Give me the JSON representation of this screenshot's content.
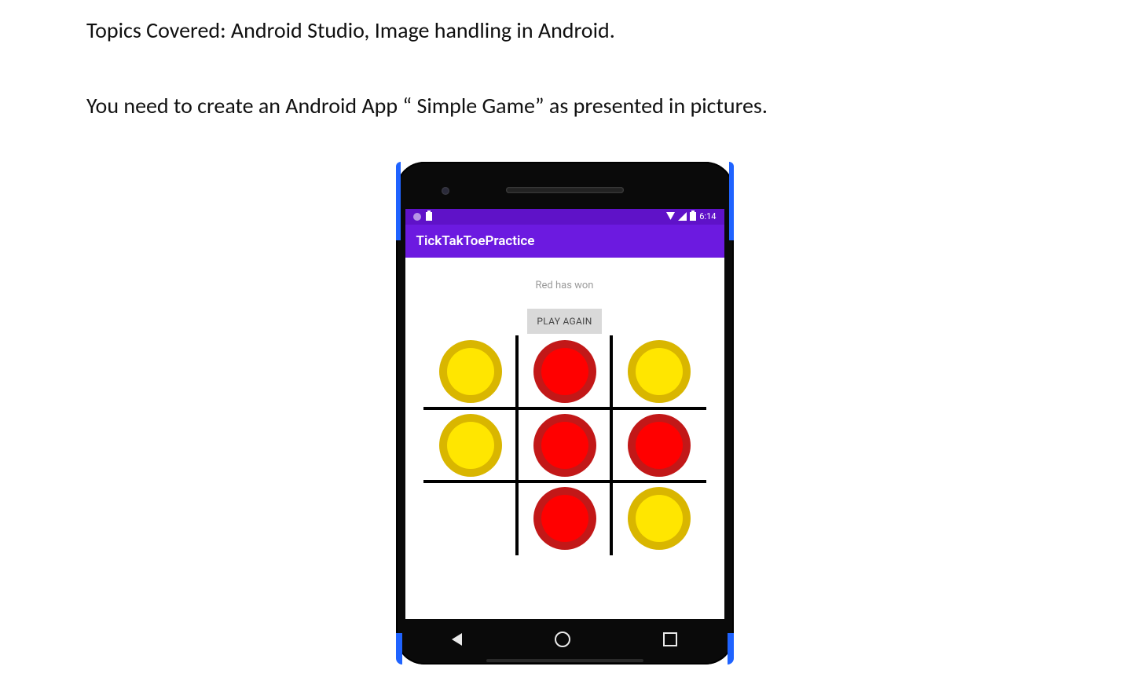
{
  "document": {
    "topic_line": "Topics Covered: Android Studio, Image handling in Android.",
    "assignment_line": "You need to create an Android App “ Simple Game” as presented in pictures."
  },
  "phone": {
    "status": {
      "time": "6:14"
    },
    "app_title": "TickTakToePractice",
    "result_text": "Red has won",
    "play_again_label": "PLAY AGAIN",
    "board": {
      "cells": [
        "yellow",
        "red",
        "yellow",
        "yellow",
        "red",
        "red",
        "empty",
        "red",
        "yellow"
      ]
    },
    "colors": {
      "action_bar": "#6c1ae0",
      "status_bar": "#5f12c8",
      "red_coin_fill": "#ff0000",
      "red_coin_rim": "#c21818",
      "yellow_coin_fill": "#ffe600",
      "yellow_coin_rim": "#d9b600"
    }
  }
}
